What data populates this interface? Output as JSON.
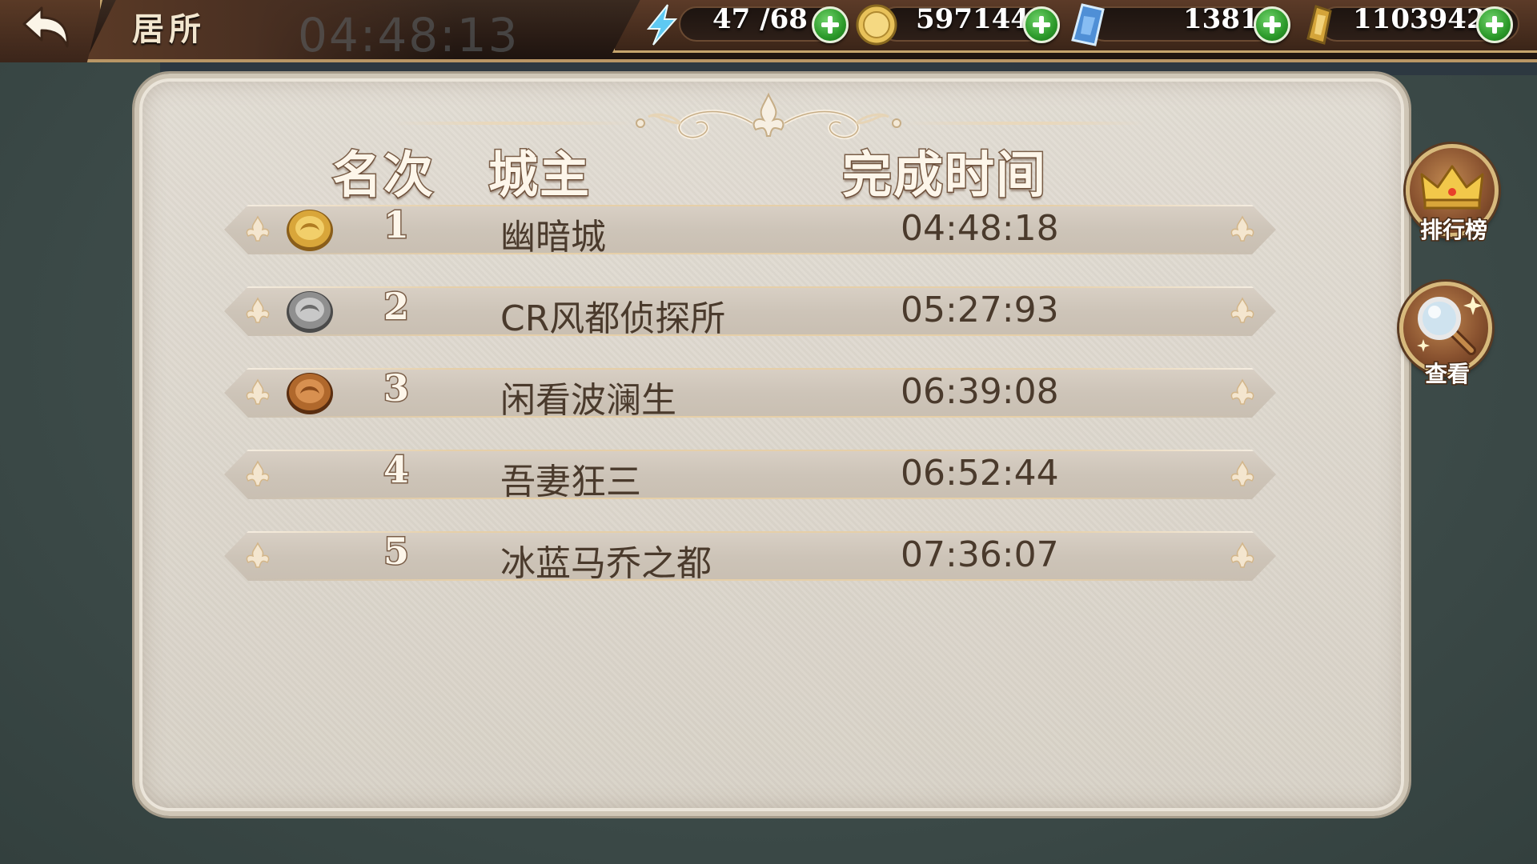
{
  "topbar": {
    "title": "居所",
    "faded_timer": "04:48:13",
    "resources": [
      {
        "name": "stamina",
        "icon": "lightning-icon",
        "value": "47 /68"
      },
      {
        "name": "gold",
        "icon": "gold-coin-icon",
        "value": "597144"
      },
      {
        "name": "crystal",
        "icon": "blue-crystal-icon",
        "value": "1381"
      },
      {
        "name": "gem",
        "icon": "gold-gem-icon",
        "value": "1103942"
      }
    ]
  },
  "table": {
    "headers": {
      "rank": "名次",
      "owner": "城主",
      "time": "完成时间"
    },
    "rows": [
      {
        "rank": "1",
        "medal": "gold",
        "name": "幽暗城",
        "time": "04:48:18"
      },
      {
        "rank": "2",
        "medal": "silver",
        "name": "CR风都侦探所",
        "time": "05:27:93"
      },
      {
        "rank": "3",
        "medal": "bronze",
        "name": "闲看波澜生",
        "time": "06:39:08"
      },
      {
        "rank": "4",
        "medal": "",
        "name": "吾妻狂三",
        "time": "06:52:44"
      },
      {
        "rank": "5",
        "medal": "",
        "name": "冰蓝马乔之都",
        "time": "07:36:07"
      }
    ]
  },
  "side": {
    "leaderboard_label": "排行榜",
    "view_label": "查看"
  },
  "colors": {
    "gold": "#d9a63a",
    "silver": "#9a9a9a",
    "bronze": "#b0682c",
    "plus_green": "#2c9a2a",
    "panel": "#dcd6cc"
  }
}
